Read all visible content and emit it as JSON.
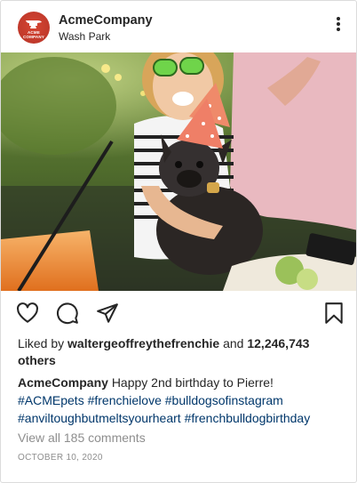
{
  "header": {
    "avatar_text": "ACME COMPANY",
    "username": "AcmeCompany",
    "location": "Wash Park"
  },
  "photo": {
    "alt": "Woman in party hat holding a French bulldog in a party hat at an outdoor table"
  },
  "likes": {
    "prefix": "Liked by",
    "user": "waltergeoffreythefrenchie",
    "joiner": "and",
    "count": "12,246,743",
    "suffix": "others"
  },
  "caption": {
    "username": "AcmeCompany",
    "text": "Happy 2nd birthday to Pierre!",
    "hashtags_line1": [
      "#ACMEpets",
      "#frenchielove",
      "#bulldogsofinstagram"
    ],
    "hashtags_line2": [
      "#anviltoughbutmeltsyourheart",
      "#frenchbulldogbirthday"
    ]
  },
  "comments_link": "View all 185 comments",
  "date": "OCTOBER 10, 2020",
  "colors": {
    "brand_red": "#c0392b",
    "hashtag_blue": "#00376b",
    "muted_gray": "#8e8e8e",
    "text": "#262626"
  }
}
